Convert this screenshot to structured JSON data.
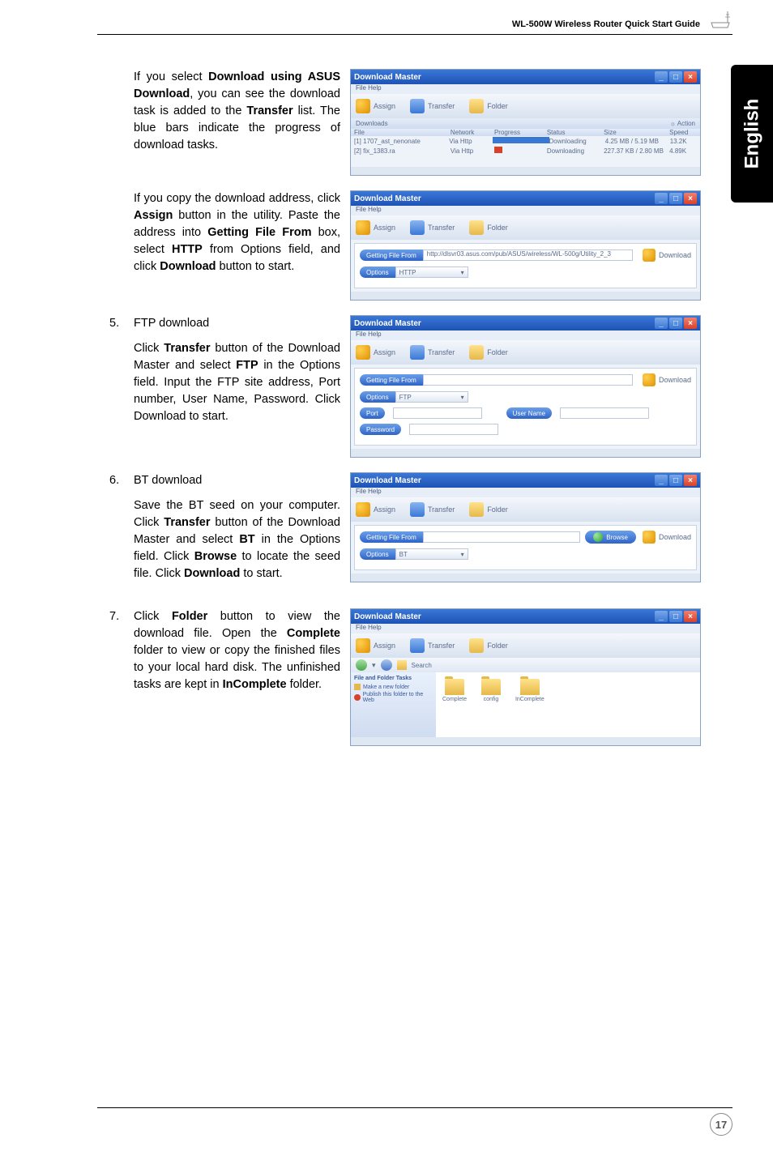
{
  "header": {
    "title": "WL-500W Wireless Router Quick Start Guide"
  },
  "side_tab": "English",
  "page_number": "17",
  "body": {
    "p1_a": "If you select ",
    "p1_b1": "Download using ASUS Download",
    "p1_c": ", you can see the download task is added to the ",
    "p1_b2": "Transfer",
    "p1_d": " list. The blue bars indicate the progress of download tasks.",
    "p2_a": "If you copy the download address, click ",
    "p2_b1": "Assign",
    "p2_c": " button in the utility. Paste the address into ",
    "p2_b2": "Getting File From",
    "p2_d": " box, select ",
    "p2_b3": "HTTP",
    "p2_e": " from Options field, and click ",
    "p2_b4": "Download",
    "p2_f": " button to start.",
    "li5_num": "5.",
    "li5_title": "FTP download",
    "li5_a": "Click ",
    "li5_b1": "Transfer",
    "li5_c": " button of the Download Master and select ",
    "li5_b2": "FTP",
    "li5_d": " in the Options field. Input the FTP site address, Port number, User Name, Password. Click Download to start.",
    "li6_num": "6.",
    "li6_title": "BT download",
    "li6_a": "Save the BT seed on your computer. Click ",
    "li6_b1": "Transfer",
    "li6_c": " button of the Download Master and select ",
    "li6_b2": "BT",
    "li6_d": " in the Options field. Click ",
    "li6_b3": "Browse",
    "li6_e": " to locate the seed file. Click ",
    "li6_b4": "Download",
    "li6_f": " to start.",
    "li7_num": "7.",
    "li7_a": "Click ",
    "li7_b1": "Folder",
    "li7_c": " button to view the download file. Open the ",
    "li7_b2": "Complete",
    "li7_d": " folder to view or copy the finished files to your local hard disk. The unfinished tasks are kept in ",
    "li7_b3": "InComplete",
    "li7_e": " folder."
  },
  "win": {
    "title": "Download Master",
    "menu": "File  Help",
    "assign": "Assign",
    "transfer": "Transfer",
    "folder": "Folder",
    "download_btn": "Download",
    "screens": {
      "s1": {
        "tab": "Downloads",
        "action": "Action",
        "headers": [
          "File",
          "Network",
          "Progress",
          "Status",
          "Size",
          "Speed"
        ],
        "rows": [
          {
            "file": "[1] 1707_ast_nenonate",
            "net": "Via Http",
            "status": "Downloading",
            "size": "4.25 MB / 5.19 MB",
            "speed": "13.2K"
          },
          {
            "file": "[2] fix_1383.ra",
            "net": "Via Http",
            "status": "Downloading",
            "size": "227.37 KB / 2.80 MB",
            "speed": "4.89K"
          }
        ]
      },
      "s2": {
        "labels": {
          "getting": "Getting File From",
          "options": "Options"
        },
        "url": "http://dlsvr03.asus.com/pub/ASUS/wireless/WL-500g/Utility_2_3",
        "option": "HTTP"
      },
      "s3": {
        "labels": {
          "getting": "Getting File From",
          "options": "Options",
          "port": "Port",
          "user": "User Name",
          "password": "Password"
        },
        "option": "FTP"
      },
      "s4": {
        "labels": {
          "getting": "Getting File From",
          "options": "Options",
          "browse": "Browse"
        },
        "option": "BT"
      },
      "s5": {
        "left_hdr": "File and Folder Tasks",
        "left_items": [
          "Make a new folder",
          "Publish this folder to the Web"
        ],
        "folders": [
          "Complete",
          "config",
          "InComplete"
        ]
      }
    }
  }
}
